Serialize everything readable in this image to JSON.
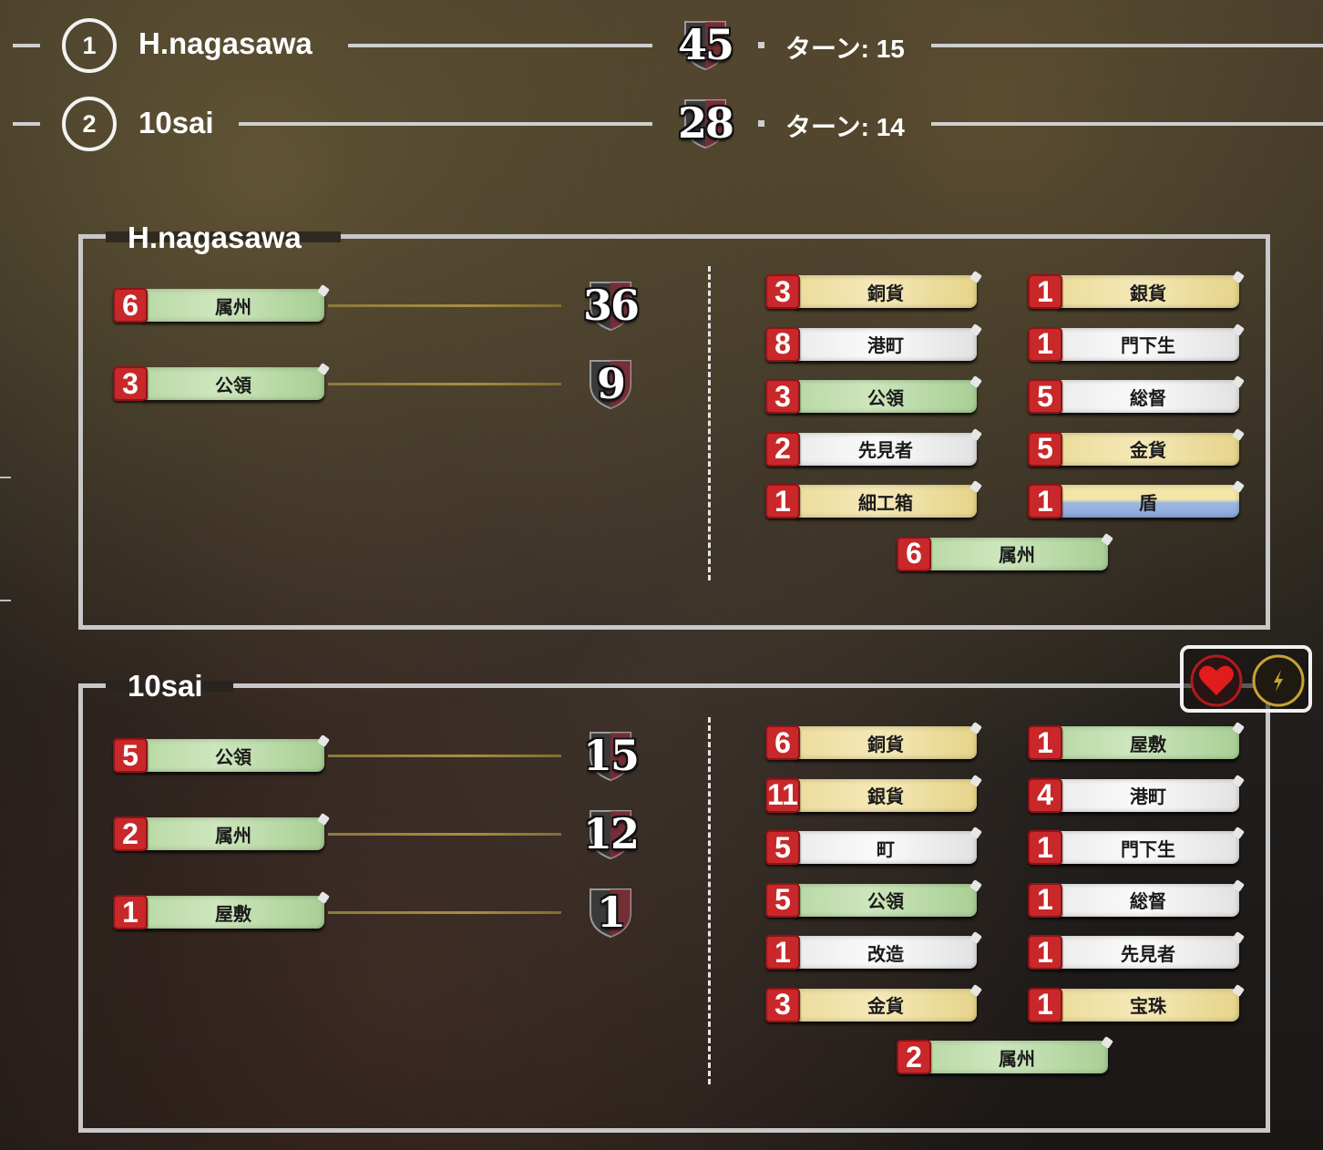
{
  "header": {
    "players": [
      {
        "rank": "1",
        "name": "H.nagasawa",
        "score": "45",
        "turn": "ターン: 15"
      },
      {
        "rank": "2",
        "name": "10sai",
        "score": "28",
        "turn": "ターン: 14"
      }
    ]
  },
  "panels": [
    {
      "title": "H.nagasawa",
      "scoring": [
        {
          "count": "6",
          "label": "属州",
          "color": "green",
          "points": "36"
        },
        {
          "count": "3",
          "label": "公領",
          "color": "green",
          "points": "9"
        }
      ],
      "cards_left": [
        {
          "count": "3",
          "label": "銅貨",
          "color": "yellow"
        },
        {
          "count": "8",
          "label": "港町",
          "color": "white"
        },
        {
          "count": "3",
          "label": "公領",
          "color": "green"
        },
        {
          "count": "2",
          "label": "先見者",
          "color": "white"
        },
        {
          "count": "1",
          "label": "細工箱",
          "color": "yellow"
        }
      ],
      "cards_right": [
        {
          "count": "1",
          "label": "銀貨",
          "color": "yellow"
        },
        {
          "count": "1",
          "label": "門下生",
          "color": "white"
        },
        {
          "count": "5",
          "label": "総督",
          "color": "white"
        },
        {
          "count": "5",
          "label": "金貨",
          "color": "yellow"
        },
        {
          "count": "1",
          "label": "盾",
          "color": "shield-blue"
        }
      ],
      "cards_bottom": {
        "count": "6",
        "label": "属州",
        "color": "green"
      }
    },
    {
      "title": "10sai",
      "scoring": [
        {
          "count": "5",
          "label": "公領",
          "color": "green",
          "points": "15"
        },
        {
          "count": "2",
          "label": "属州",
          "color": "green",
          "points": "12"
        },
        {
          "count": "1",
          "label": "屋敷",
          "color": "green",
          "points": "1"
        }
      ],
      "cards_left": [
        {
          "count": "6",
          "label": "銅貨",
          "color": "yellow"
        },
        {
          "count": "11",
          "label": "銀貨",
          "color": "yellow"
        },
        {
          "count": "5",
          "label": "町",
          "color": "white"
        },
        {
          "count": "5",
          "label": "公領",
          "color": "green"
        },
        {
          "count": "1",
          "label": "改造",
          "color": "white"
        },
        {
          "count": "3",
          "label": "金貨",
          "color": "yellow"
        }
      ],
      "cards_right": [
        {
          "count": "1",
          "label": "屋敷",
          "color": "green"
        },
        {
          "count": "4",
          "label": "港町",
          "color": "white"
        },
        {
          "count": "1",
          "label": "門下生",
          "color": "white"
        },
        {
          "count": "1",
          "label": "総督",
          "color": "white"
        },
        {
          "count": "1",
          "label": "先見者",
          "color": "white"
        },
        {
          "count": "1",
          "label": "宝珠",
          "color": "yellow"
        }
      ],
      "cards_bottom": {
        "count": "2",
        "label": "属州",
        "color": "green"
      }
    }
  ],
  "status_icons": [
    {
      "icon": "heart-icon",
      "color": "#d01818"
    },
    {
      "icon": "lightning-icon",
      "color": "#c9a233"
    }
  ]
}
